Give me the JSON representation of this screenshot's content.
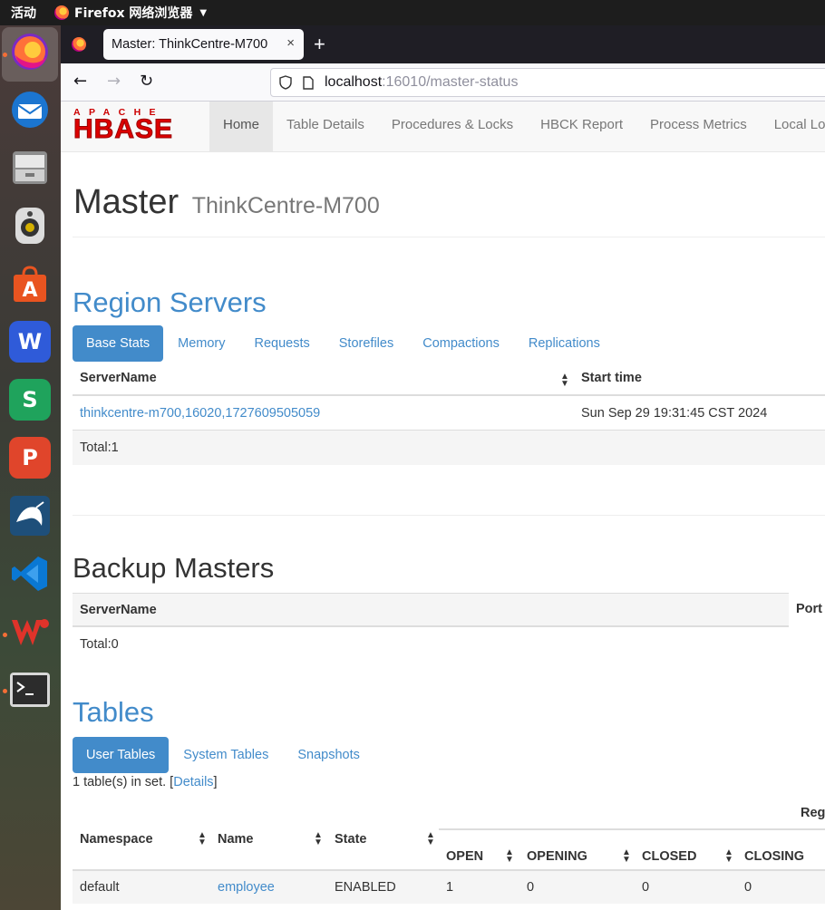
{
  "topbar": {
    "activities": "活动",
    "app_name": "Firefox 网络浏览器"
  },
  "dock": {
    "apps": [
      "firefox-icon",
      "thunderbird-icon",
      "files-icon",
      "rhythmbox-icon",
      "software-center-icon",
      "wps-writer-icon",
      "wps-spreadsheets-icon",
      "wps-presentation-icon",
      "mysql-workbench-icon",
      "vscode-icon",
      "wps-office-icon",
      "terminal-icon"
    ],
    "letters": {
      "writer": "W",
      "sheets": "S",
      "presentation": "P",
      "software": "A"
    }
  },
  "browser": {
    "tab_title": "Master: ThinkCentre-M700",
    "tab_close": "×",
    "new_tab": "+",
    "url_host": "localhost",
    "url_rest": ":16010/master-status"
  },
  "nav": {
    "logo_top": "APACHE",
    "logo_main": "HBASE",
    "links": [
      "Home",
      "Table Details",
      "Procedures & Locks",
      "HBCK Report",
      "Process Metrics",
      "Local Logs"
    ]
  },
  "master": {
    "title": "Master",
    "hostname": "ThinkCentre-M700"
  },
  "region_servers": {
    "heading": "Region Servers",
    "tabs": [
      "Base Stats",
      "Memory",
      "Requests",
      "Storefiles",
      "Compactions",
      "Replications"
    ],
    "columns": [
      "ServerName",
      "Start time"
    ],
    "rows": [
      {
        "server": "thinkcentre-m700,16020,1727609505059",
        "start": "Sun Sep 29 19:31:45 CST 2024"
      }
    ],
    "total": "Total:1"
  },
  "backup_masters": {
    "heading": "Backup Masters",
    "columns": [
      "ServerName",
      "Port"
    ],
    "total": "Total:0"
  },
  "tables": {
    "heading": "Tables",
    "tabs": [
      "User Tables",
      "System Tables",
      "Snapshots"
    ],
    "count_text": "1 table(s) in set. [",
    "details_link": "Details",
    "count_close": "]",
    "group_header": "Reg",
    "columns": [
      "Namespace",
      "Name",
      "State"
    ],
    "sub_columns": [
      "OPEN",
      "OPENING",
      "CLOSED",
      "CLOSING"
    ],
    "rows": [
      {
        "namespace": "default",
        "name": "employee",
        "state": "ENABLED",
        "open": "1",
        "opening": "0",
        "closed": "0",
        "closing": "0"
      }
    ]
  },
  "colors": {
    "link": "#428bca",
    "topbar": "#1d1d1d",
    "tabbar": "#1f1e25"
  }
}
